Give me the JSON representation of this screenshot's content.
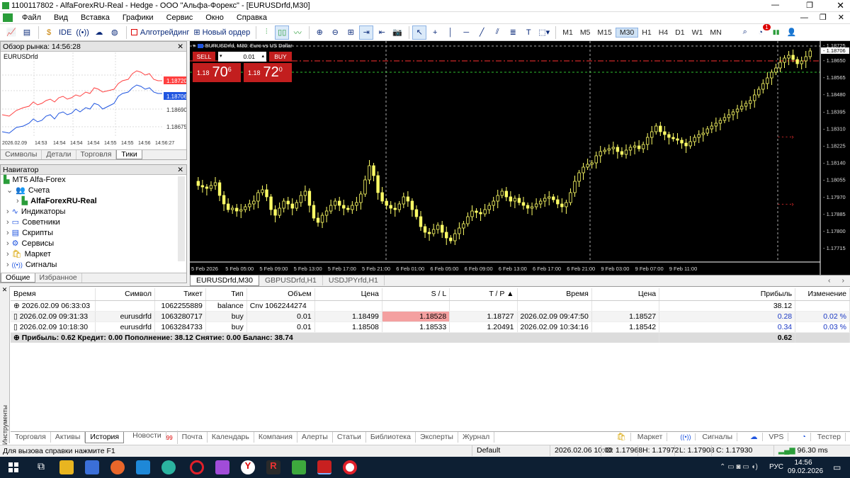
{
  "window": {
    "title": "1100117802 - AlfaForexRU-Real - Hedge - ООО \"Альфа-Форекс\" - [EURUSDrfd,M30]"
  },
  "menu": [
    "Файл",
    "Вид",
    "Вставка",
    "Графики",
    "Сервис",
    "Окно",
    "Справка"
  ],
  "toolbar": {
    "ide": "IDE",
    "algo": "Алготрейдинг",
    "new_order": "Новый ордер",
    "timeframes": [
      "M1",
      "M5",
      "M15",
      "M30",
      "H1",
      "H4",
      "D1",
      "W1",
      "MN"
    ],
    "active_tf": "M30",
    "notif_count": "1"
  },
  "market_watch": {
    "title": "Обзор рынка: 14:56:28",
    "symbol": "EURUSDrfd",
    "price_red": "1.18720",
    "price_blue": "1.18706",
    "y_ticks": [
      "1.18690",
      "1.18675"
    ],
    "x_ticks": [
      "2026.02.09",
      "14:53",
      "14:54",
      "14:54",
      "14:54",
      "14:55",
      "14:55",
      "14:56",
      "14:56:27"
    ],
    "tabs": [
      "Символы",
      "Детали",
      "Торговля",
      "Тики"
    ],
    "active_tab": "Тики"
  },
  "navigator": {
    "title": "Навигатор",
    "root": "MT5 Alfa-Forex",
    "items": [
      {
        "label": "Счета",
        "icon": "accounts-icon"
      },
      {
        "label": "AlfaForexRU-Real",
        "icon": "account-icon",
        "bold": true
      },
      {
        "label": "Индикаторы",
        "icon": "indicators-icon"
      },
      {
        "label": "Советники",
        "icon": "experts-icon"
      },
      {
        "label": "Скрипты",
        "icon": "scripts-icon"
      },
      {
        "label": "Сервисы",
        "icon": "services-icon"
      },
      {
        "label": "Маркет",
        "icon": "market-icon"
      },
      {
        "label": "Сигналы",
        "icon": "signals-icon"
      }
    ],
    "tabs": [
      "Общие",
      "Избранное"
    ]
  },
  "chart": {
    "header": "EURUSDrfd, M30:  Euro vs US Dollar",
    "sell_label": "SELL",
    "buy_label": "BUY",
    "volume": "0.01",
    "sell_prefix": "1.18",
    "sell_big": "70",
    "sell_sup": "6",
    "buy_prefix": "1.18",
    "buy_big": "72",
    "buy_sup": "0",
    "price_labels": [
      "1.18725",
      "1.18706",
      "1.18650",
      "1.18565",
      "1.18480",
      "1.18395",
      "1.18310",
      "1.18225",
      "1.18140",
      "1.18055",
      "1.17970",
      "1.17885",
      "1.17800",
      "1.17715"
    ],
    "time_labels": [
      "5 Feb 2026",
      "5 Feb 05:00",
      "5 Feb 09:00",
      "5 Feb 13:00",
      "5 Feb 17:00",
      "5 Feb 21:00",
      "6 Feb 01:00",
      "6 Feb 05:00",
      "6 Feb 09:00",
      "6 Feb 13:00",
      "6 Feb 17:00",
      "6 Feb 21:00",
      "9 Feb 03:00",
      "9 Feb 07:00",
      "9 Feb 11:00"
    ],
    "tabs": [
      "EURUSDrfd,M30",
      "GBPUSDrfd,H1",
      "USDJPYrfd,H1"
    ]
  },
  "history": {
    "headers": [
      "Время",
      "Символ",
      "Тикет",
      "Тип",
      "Объем",
      "Цена",
      "S / L",
      "T / P",
      "Время",
      "Цена",
      "Прибыль",
      "Изменение"
    ],
    "rows": [
      {
        "time": "2026.02.09 06:33:03",
        "symbol": "",
        "ticket": "1062255889",
        "type": "balance",
        "volume": "Cnv 1062244274",
        "price": "",
        "sl": "",
        "tp": "",
        "time2": "",
        "price2": "",
        "profit": "38.12",
        "change": ""
      },
      {
        "time": "2026.02.09 09:31:33",
        "symbol": "eurusdrfd",
        "ticket": "1063280717",
        "type": "buy",
        "volume": "0.01",
        "price": "1.18499",
        "sl": "1.18528",
        "tp": "1.18727",
        "time2": "2026.02.09 09:47:50",
        "price2": "1.18527",
        "profit": "0.28",
        "change": "0.02 %"
      },
      {
        "time": "2026.02.09 10:18:30",
        "symbol": "eurusdrfd",
        "ticket": "1063284733",
        "type": "buy",
        "volume": "0.01",
        "price": "1.18508",
        "sl": "1.18533",
        "tp": "1.20491",
        "time2": "2026.02.09 10:34:16",
        "price2": "1.18542",
        "profit": "0.34",
        "change": "0.03 %"
      }
    ],
    "summary": "Прибыль: 0.62  Кредит: 0.00  Пополнение: 38.12  Снятие: 0.00  Баланс: 38.74",
    "summary_profit": "0.62"
  },
  "sidebar_label": "Инструменты",
  "bottom_tabs": [
    "Торговля",
    "Активы",
    "История",
    "Новости",
    "Почта",
    "Календарь",
    "Компания",
    "Алерты",
    "Статьи",
    "Библиотека",
    "Эксперты",
    "Журнал"
  ],
  "active_bottom_tab": "История",
  "news_count": "99",
  "right_tabs": [
    "Маркет",
    "Сигналы",
    "VPS",
    "Тестер"
  ],
  "status": {
    "help": "Для вызова справки нажмите F1",
    "profile": "Default",
    "datetime": "2026.02.06 10:00",
    "o": "O: 1.17968",
    "h": "H: 1.17972",
    "l": "L: 1.17908",
    "c": "C: 1.17930",
    "ping": "96.30 ms"
  },
  "taskbar": {
    "lang": "РУС",
    "time": "14:56",
    "date": "09.02.2026"
  },
  "colors": {
    "bull": "#ffff66",
    "bear": "#ffff66",
    "sell_bg": "#c21e1e",
    "buy_bg": "#c21e1e",
    "red_line": "#ff4040",
    "blue_line": "#1f55e0"
  }
}
